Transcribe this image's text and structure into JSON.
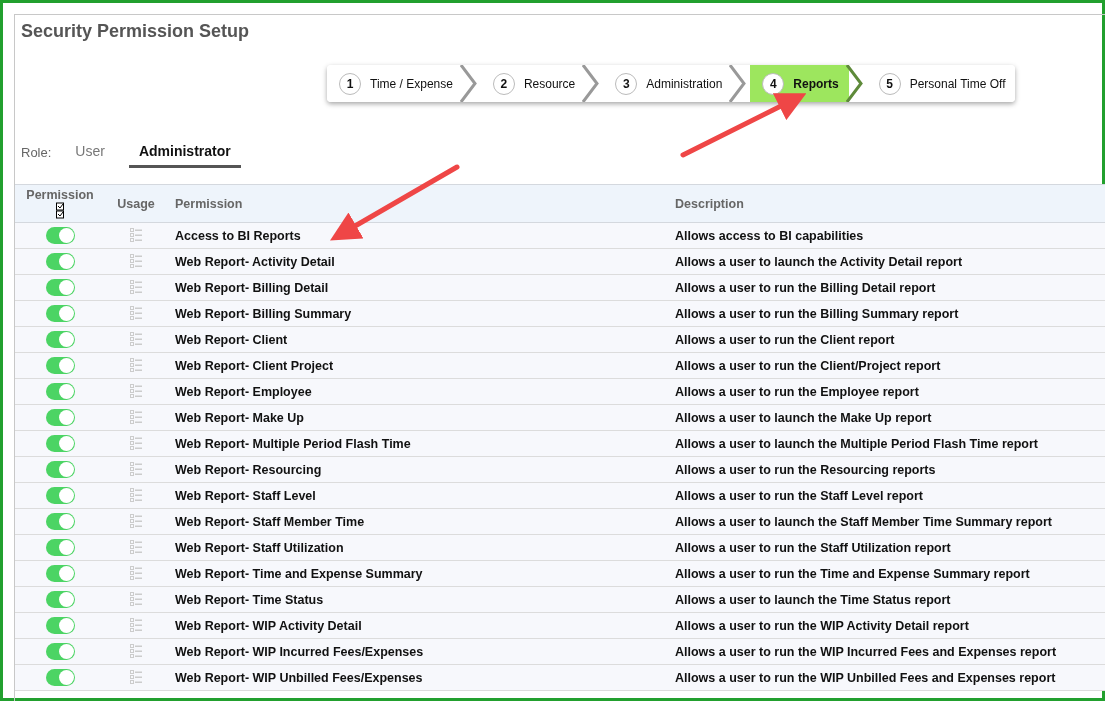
{
  "title": "Security Permission Setup",
  "steps": [
    {
      "number": "1",
      "label": "Time / Expense",
      "selected": false
    },
    {
      "number": "2",
      "label": "Resource",
      "selected": false
    },
    {
      "number": "3",
      "label": "Administration",
      "selected": false
    },
    {
      "number": "4",
      "label": "Reports",
      "selected": true
    },
    {
      "number": "5",
      "label": "Personal Time Off",
      "selected": false
    }
  ],
  "role": {
    "label": "Role:",
    "tabs": [
      {
        "label": "User",
        "selected": false
      },
      {
        "label": "Administrator",
        "selected": true
      }
    ]
  },
  "table": {
    "columns": [
      "Permission",
      "Usage",
      "Permission",
      "Description"
    ],
    "rows": [
      {
        "on": true,
        "permission": "Access to BI Reports",
        "description": "Allows access to BI capabilities"
      },
      {
        "on": true,
        "permission": "Web Report- Activity Detail",
        "description": "Allows a user to launch the Activity Detail report"
      },
      {
        "on": true,
        "permission": "Web Report- Billing Detail",
        "description": "Allows a user to run the Billing Detail report"
      },
      {
        "on": true,
        "permission": "Web Report- Billing Summary",
        "description": "Allows a user to run the Billing Summary report"
      },
      {
        "on": true,
        "permission": "Web Report- Client",
        "description": "Allows a user to run the Client report"
      },
      {
        "on": true,
        "permission": "Web Report- Client Project",
        "description": "Allows a user to run the Client/Project report"
      },
      {
        "on": true,
        "permission": "Web Report- Employee",
        "description": "Allows a user to run the Employee report"
      },
      {
        "on": true,
        "permission": "Web Report- Make Up",
        "description": "Allows a user to launch the Make Up report"
      },
      {
        "on": true,
        "permission": "Web Report- Multiple Period Flash Time",
        "description": "Allows a user to launch the Multiple Period Flash Time report"
      },
      {
        "on": true,
        "permission": "Web Report- Resourcing",
        "description": "Allows a user to run the Resourcing reports"
      },
      {
        "on": true,
        "permission": "Web Report- Staff Level",
        "description": "Allows a user to run the Staff Level report"
      },
      {
        "on": true,
        "permission": "Web Report- Staff Member Time",
        "description": "Allows a user to launch the Staff Member Time Summary report"
      },
      {
        "on": true,
        "permission": "Web Report- Staff Utilization",
        "description": "Allows a user to run the Staff Utilization report"
      },
      {
        "on": true,
        "permission": "Web Report- Time and Expense Summary",
        "description": "Allows a user to run the Time and Expense Summary report"
      },
      {
        "on": true,
        "permission": "Web Report- Time Status",
        "description": "Allows a user to launch the Time Status report"
      },
      {
        "on": true,
        "permission": "Web Report- WIP Activity Detail",
        "description": "Allows a user to run the WIP Activity Detail report"
      },
      {
        "on": true,
        "permission": "Web Report- WIP Incurred Fees/Expenses",
        "description": "Allows a user to run the WIP Incurred Fees and Expenses report"
      },
      {
        "on": true,
        "permission": "Web Report- WIP Unbilled Fees/Expenses",
        "description": "Allows a user to run the WIP Unbilled Fees and Expenses report"
      }
    ]
  }
}
